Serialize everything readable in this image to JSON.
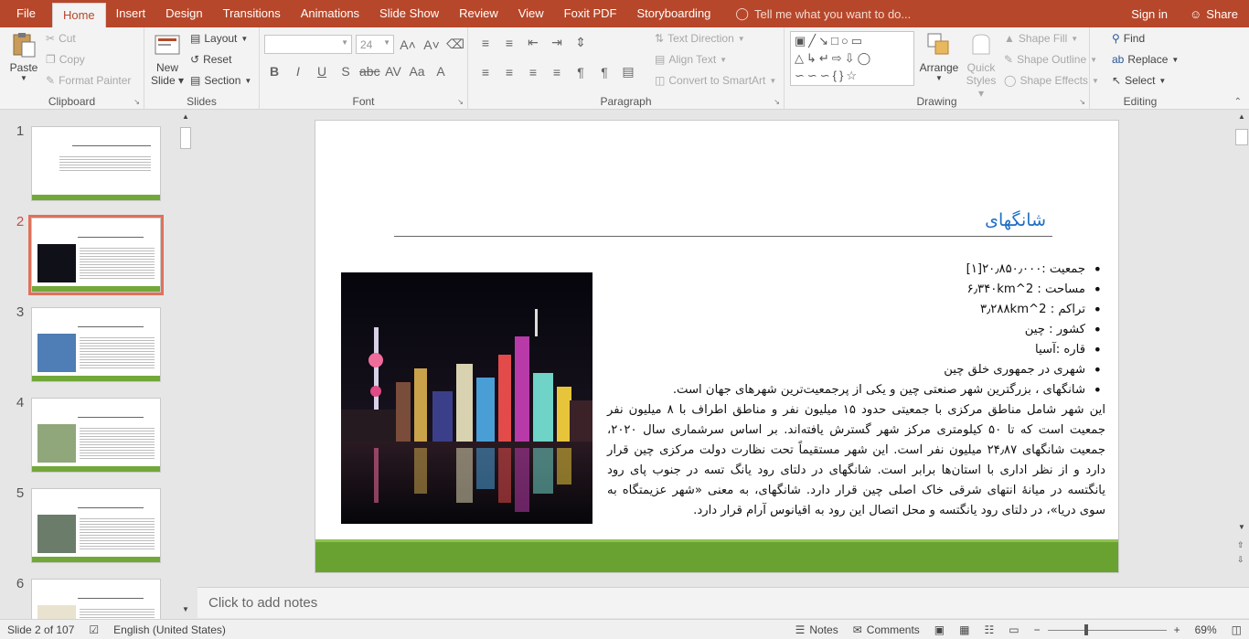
{
  "tabs": {
    "file": "File",
    "home": "Home",
    "insert": "Insert",
    "design": "Design",
    "transitions": "Transitions",
    "animations": "Animations",
    "slideshow": "Slide Show",
    "review": "Review",
    "view": "View",
    "foxit": "Foxit PDF",
    "storyboarding": "Storyboarding",
    "tell_me": "Tell me what you want to do...",
    "signin": "Sign in",
    "share": "Share"
  },
  "ribbon": {
    "clipboard": {
      "paste": "Paste",
      "cut": "Cut",
      "copy": "Copy",
      "format_painter": "Format Painter",
      "label": "Clipboard"
    },
    "slides": {
      "new_slide": "New",
      "new_slide2": "Slide",
      "layout": "Layout",
      "reset": "Reset",
      "section": "Section",
      "label": "Slides"
    },
    "font": {
      "size": "24",
      "label": "Font"
    },
    "paragraph": {
      "text_direction": "Text Direction",
      "align_text": "Align Text",
      "smartart": "Convert to SmartArt",
      "label": "Paragraph"
    },
    "drawing": {
      "arrange": "Arrange",
      "quick1": "Quick",
      "quick2": "Styles",
      "shape_fill": "Shape Fill",
      "shape_outline": "Shape Outline",
      "shape_effects": "Shape Effects",
      "label": "Drawing"
    },
    "editing": {
      "find": "Find",
      "replace": "Replace",
      "select": "Select",
      "label": "Editing"
    }
  },
  "thumbnails": [
    "1",
    "2",
    "3",
    "4",
    "5",
    "6"
  ],
  "slide": {
    "title": "شانگهای",
    "bullets": [
      "جمعیت :۲۰٫۸۵۰٫۰۰۰[۱]",
      "مساحت : 2^۶٫۳۴۰km",
      "تراکم : 2^۳٫۲۸۸km",
      "کشور : چین",
      "قاره :آسیا",
      "شهری در جمهوری خلق چین",
      "شانگهای ، بزرگترین شهر صنعتی چین و یکی از پرجمعیت‌ترین شهرهای جهان است."
    ],
    "paragraph": "این شهر شامل مناطق مرکزی با جمعیتی حدود ۱۵ میلیون نفر و مناطق اطراف با ۸ میلیون نفر جمعیت است که تا ۵۰ کیلومتری مرکز شهر گسترش یافته‌اند. بر اساس سرشماری سال ۲۰۲۰، جمعیت شانگهای ۲۴٫۸۷ میلیون نفر است. این شهر مستقیماً تحت نظارت دولت مرکزی چین قرار دارد و از نظر اداری با استان‌ها برابر است. شانگهای در دلتای رود یانگ تسه در جنوب پای رود یانگتسه در میانهٔ انتهای شرقی خاک اصلی چین قرار دارد. شانگهای، به معنی «شهر عزیمتگاه به سوی دریا»، در دلتای رود یانگتسه و محل اتصال این رود به اقیانوس آرام قرار دارد."
  },
  "notes_placeholder": "Click to add notes",
  "status": {
    "slide_info": "Slide 2 of 107",
    "language": "English (United States)",
    "notes": "Notes",
    "comments": "Comments",
    "zoom": "69%",
    "zoom_level": 0.69
  },
  "colors": {
    "accent": "#b7472a",
    "slide_bar": "#6aa232",
    "title": "#1f6fc5",
    "selected_thumb": "#e0715a"
  }
}
